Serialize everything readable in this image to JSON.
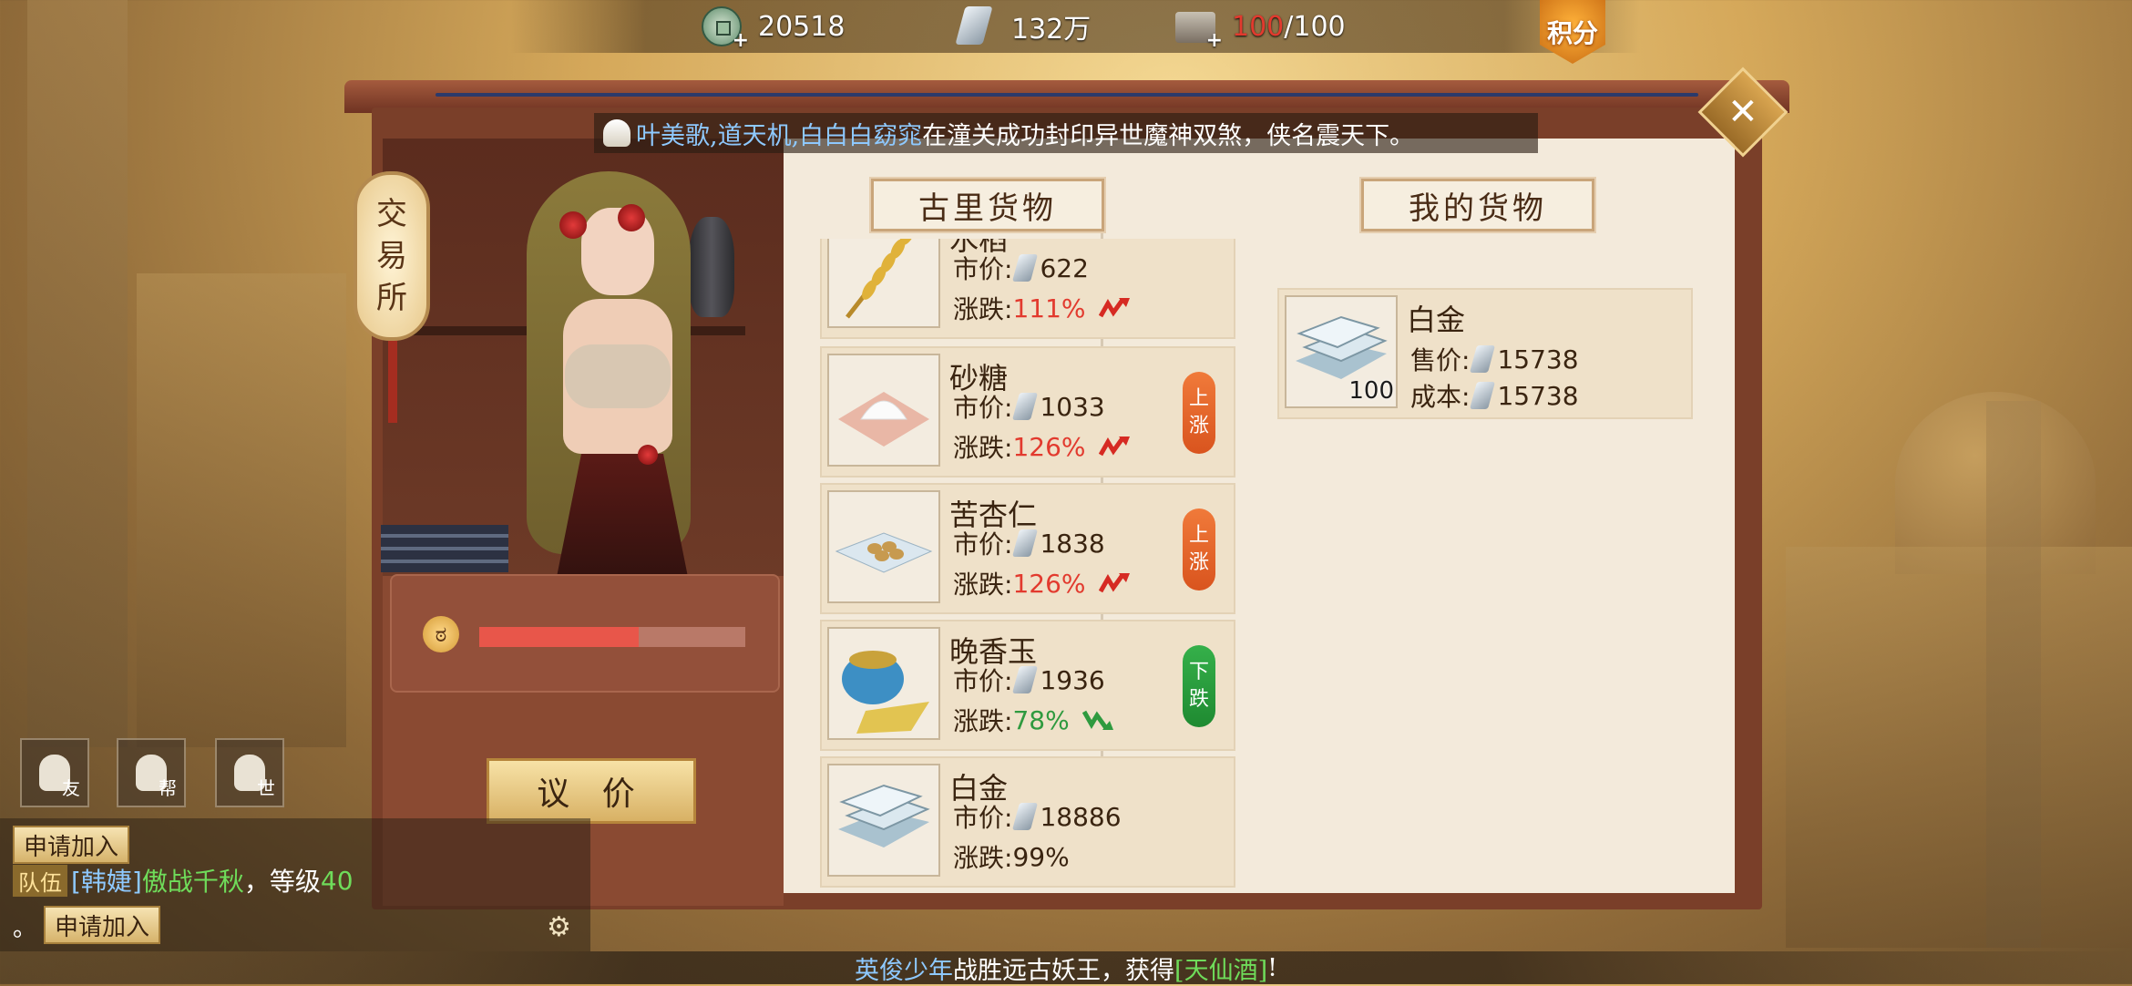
{
  "topbar": {
    "copper": "20518",
    "silver": "132万",
    "capacity_current": "100",
    "capacity_max": "/100",
    "points_label": "积分"
  },
  "announcement": {
    "names": "叶美歌,道天机,白白白窈窕",
    "text": "在潼关成功封印异世魔神双煞，侠名震天下。"
  },
  "shop": {
    "sign": [
      "交",
      "易",
      "所"
    ],
    "bargain_label": "议 价",
    "mood_fraction": 0.6
  },
  "tabs": {
    "merchant_goods": "古里货物",
    "my_goods": "我的货物"
  },
  "labels": {
    "market_price": "市价:",
    "change": "涨跌:",
    "sell_price": "售价:",
    "cost": "成本:"
  },
  "merchant_goods": [
    {
      "name": "水稻",
      "price": "622",
      "change": "111%",
      "trend": "up",
      "badge": ""
    },
    {
      "name": "砂糖",
      "price": "1033",
      "change": "126%",
      "trend": "up",
      "badge": "上涨"
    },
    {
      "name": "苦杏仁",
      "price": "1838",
      "change": "126%",
      "trend": "up",
      "badge": "上涨"
    },
    {
      "name": "晚香玉",
      "price": "1936",
      "change": "78%",
      "trend": "down",
      "badge": "下跌"
    },
    {
      "name": "白金",
      "price": "18886",
      "change": "99%",
      "trend": "flat",
      "badge": ""
    }
  ],
  "my_goods": [
    {
      "name": "白金",
      "sell_price": "15738",
      "cost": "15738",
      "qty": "100"
    }
  ],
  "chat": {
    "join_label": "申请加入",
    "team_tag": "队伍",
    "player": "[韩婕]",
    "message_green": "傲战千秋",
    "message_rest": "，等级",
    "level": "40",
    "buttons": [
      {
        "tag": "友"
      },
      {
        "tag": "帮"
      },
      {
        "tag": "世"
      }
    ],
    "dot": "。"
  },
  "broadcast": {
    "player": "英俊少年",
    "text": "战胜远古妖王，获得",
    "item": "[天仙酒]",
    "end": "!"
  },
  "colors": {
    "up": "#e23a2e",
    "down": "#2f9a3f",
    "panel_bg": "#f3eadb",
    "wood": "#7a3f29"
  }
}
